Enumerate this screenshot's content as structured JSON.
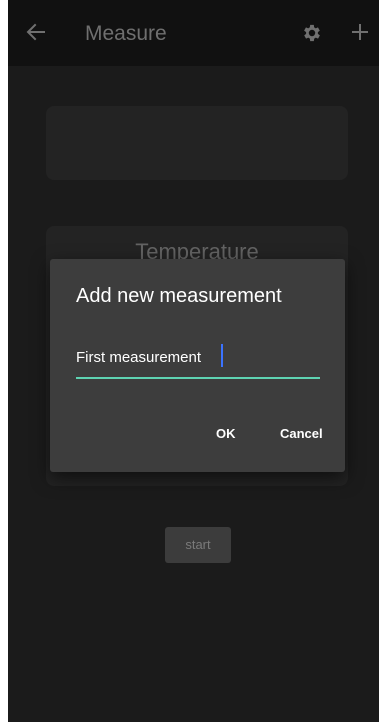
{
  "app_bar": {
    "title": "Measure",
    "back_icon": "arrow-left-icon",
    "settings_icon": "gear-icon",
    "add_icon": "plus-icon",
    "background": "#111111"
  },
  "main": {
    "temperature_card_label": "Temperature",
    "start_button_label": "start"
  },
  "dialog": {
    "title": "Add new measurement",
    "input_value": "First measurement",
    "ok_label": "OK",
    "cancel_label": "Cancel",
    "accent_color": "#5ed3b2",
    "background": "#3d3d3d"
  }
}
